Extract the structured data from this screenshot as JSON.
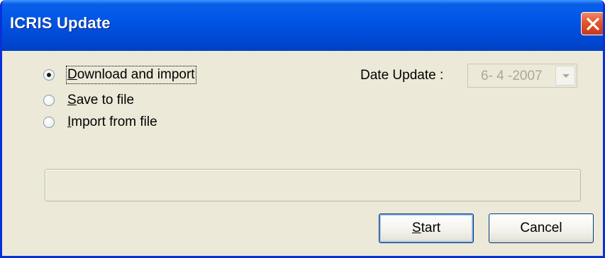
{
  "window": {
    "title": "ICRIS Update"
  },
  "options": [
    {
      "mnemonic": "D",
      "rest": "ownload and import",
      "checked": true
    },
    {
      "mnemonic": "S",
      "rest": "ave to file",
      "checked": false
    },
    {
      "mnemonic": "I",
      "rest": "mport from file",
      "checked": false
    }
  ],
  "date_update": {
    "label": "Date Update :",
    "value": "6- 4 -2007"
  },
  "progress": {
    "value": 0
  },
  "buttons": {
    "start_mnemonic": "S",
    "start_rest": "tart",
    "cancel_label": "Cancel"
  },
  "colors": {
    "titlebar": "#0055e5",
    "close_button": "#e3552b",
    "dialog_background": "#ece9d8"
  },
  "icons": {
    "close": "close-icon",
    "dropdown": "chevron-down-icon"
  }
}
